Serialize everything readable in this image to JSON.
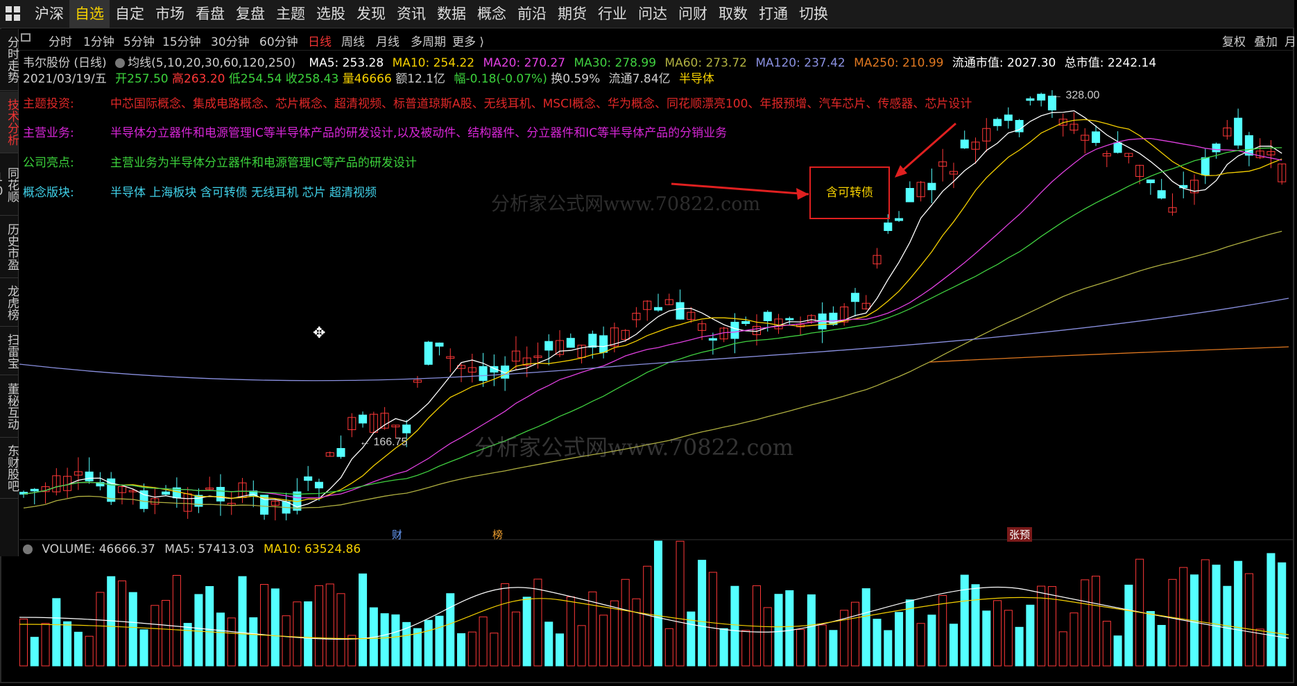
{
  "menu": [
    "沪深",
    "自选",
    "自定",
    "市场",
    "看盘",
    "复盘",
    "主题",
    "选股",
    "发现",
    "资讯",
    "数据",
    "概念",
    "前沿",
    "期货",
    "行业",
    "问达",
    "问财",
    "取数",
    "打通",
    "切换"
  ],
  "menu_active": 1,
  "left_tabs": [
    "分时走势",
    "技术分析",
    "同花顺10",
    "历史市盈",
    "龙虎榜",
    "扫雷宝",
    "董秘互动",
    "东财股吧"
  ],
  "left_tab_active": 1,
  "periods": [
    "分时",
    "1分钟",
    "5分钟",
    "15分钟",
    "30分钟",
    "60分钟",
    "日线",
    "周线",
    "月线",
    "多周期",
    "更多 ⟩"
  ],
  "period_active": 6,
  "right_tools": [
    "复权",
    "叠加",
    "月"
  ],
  "stock": {
    "title": "韦尔股份 (日线)",
    "ma_label": "均线(5,10,20,30,60,120,250)",
    "ma5": "MA5: 253.28",
    "ma10": "MA10: 254.22",
    "ma20": "MA20: 270.27",
    "ma30": "MA30: 278.99",
    "ma60": "MA60: 273.72",
    "ma120": "MA120: 237.42",
    "ma250": "MA250: 210.99",
    "float_cap": "流通市值: 2027.30",
    "total_cap": "总市值: 2242.14",
    "date": "2021/03/19/五",
    "open": "开257.50",
    "high": "高263.20",
    "low": "低254.54",
    "close": "收258.43",
    "volume": "量46666",
    "amount": "额12.1亿",
    "change": "幅-0.18(-0.07%)",
    "turnover": "换0.59%",
    "float_shares": "流通7.84亿",
    "sector": "半导体"
  },
  "info_rows": [
    {
      "key": "主题投资:",
      "value": "中芯国际概念、集成电路概念、芯片概念、超清视频、标普道琼斯A股、无线耳机、MSCI概念、华为概念、同花顺漂亮100、年报预增、汽车芯片、传感器、芯片设计",
      "color": "#e02828"
    },
    {
      "key": "主营业务:",
      "value": "半导体分立器件和电源管理IC等半导体产品的研发设计,以及被动件、结构器件、分立器件和IC等半导体产品的分销业务",
      "color": "#d626d6"
    },
    {
      "key": "公司亮点:",
      "value": "主营业务为半导体分立器件和电源管理IC等产品的研发设计",
      "color": "#3cd23c"
    },
    {
      "key": "概念版块:",
      "value": "半导体 上海板块 含可转债 无线耳机 芯片 超清视频",
      "color": "#40d0e8"
    }
  ],
  "chart_labels": {
    "high": "328.00",
    "low": "166.75"
  },
  "badges": {
    "cai": "财",
    "bang": "榜",
    "zhangyu": "张预"
  },
  "annotation": "含可转债",
  "watermark": "分析家公式网www.70822.com",
  "volume_info": {
    "vol": "VOLUME: 46666.37",
    "ma5": "MA5: 57413.03",
    "ma10": "MA10: 63524.86"
  },
  "colors": {
    "up": "#ff3838",
    "down": "#54ffff",
    "ma5": "#ffffff",
    "ma10": "#f5d000",
    "ma20": "#e040e0",
    "ma30": "#40d040",
    "ma60": "#b0b040",
    "ma120": "#8a90e0",
    "ma250": "#e07820",
    "bg": "#000000"
  }
}
